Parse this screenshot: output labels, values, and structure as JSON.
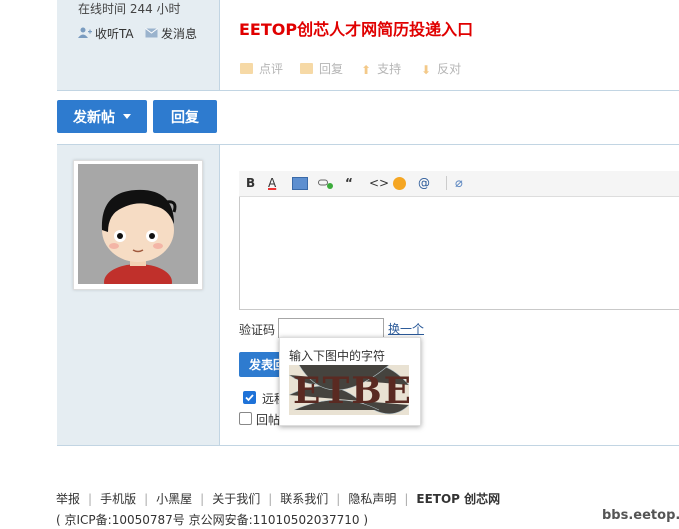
{
  "top_post": {
    "online_time": "在线时间   244 小时",
    "follow_label": "收听TA",
    "message_label": "发消息",
    "recruit_link": "EETOP创芯人才网简历投递入口",
    "actions": [
      "点评",
      "回复",
      "支持",
      "反对"
    ]
  },
  "buttons": {
    "new_post": "发新帖",
    "reply": "回复"
  },
  "editor": {
    "toolbar": {
      "bold": "B",
      "color": "A",
      "quote": "“",
      "code": "<>",
      "at": "@"
    }
  },
  "captcha": {
    "label": "验证码",
    "change_link": "换一个",
    "popup_text": "输入下图中的字符",
    "image_text": "ETBE"
  },
  "submit": {
    "label": "发表回复"
  },
  "options": [
    {
      "label": "远程",
      "checked": true
    },
    {
      "label": "回帖后跳转到最后一页",
      "checked": false
    }
  ],
  "footer": {
    "links": [
      "举报",
      "手机版",
      "小黑屋",
      "关于我们",
      "联系我们",
      "隐私声明",
      "EETOP 创芯网"
    ],
    "icp": "( 京ICP备:10050787号 京公网安备:11010502037710 )",
    "watermark": "bbs.eetop.cn"
  }
}
